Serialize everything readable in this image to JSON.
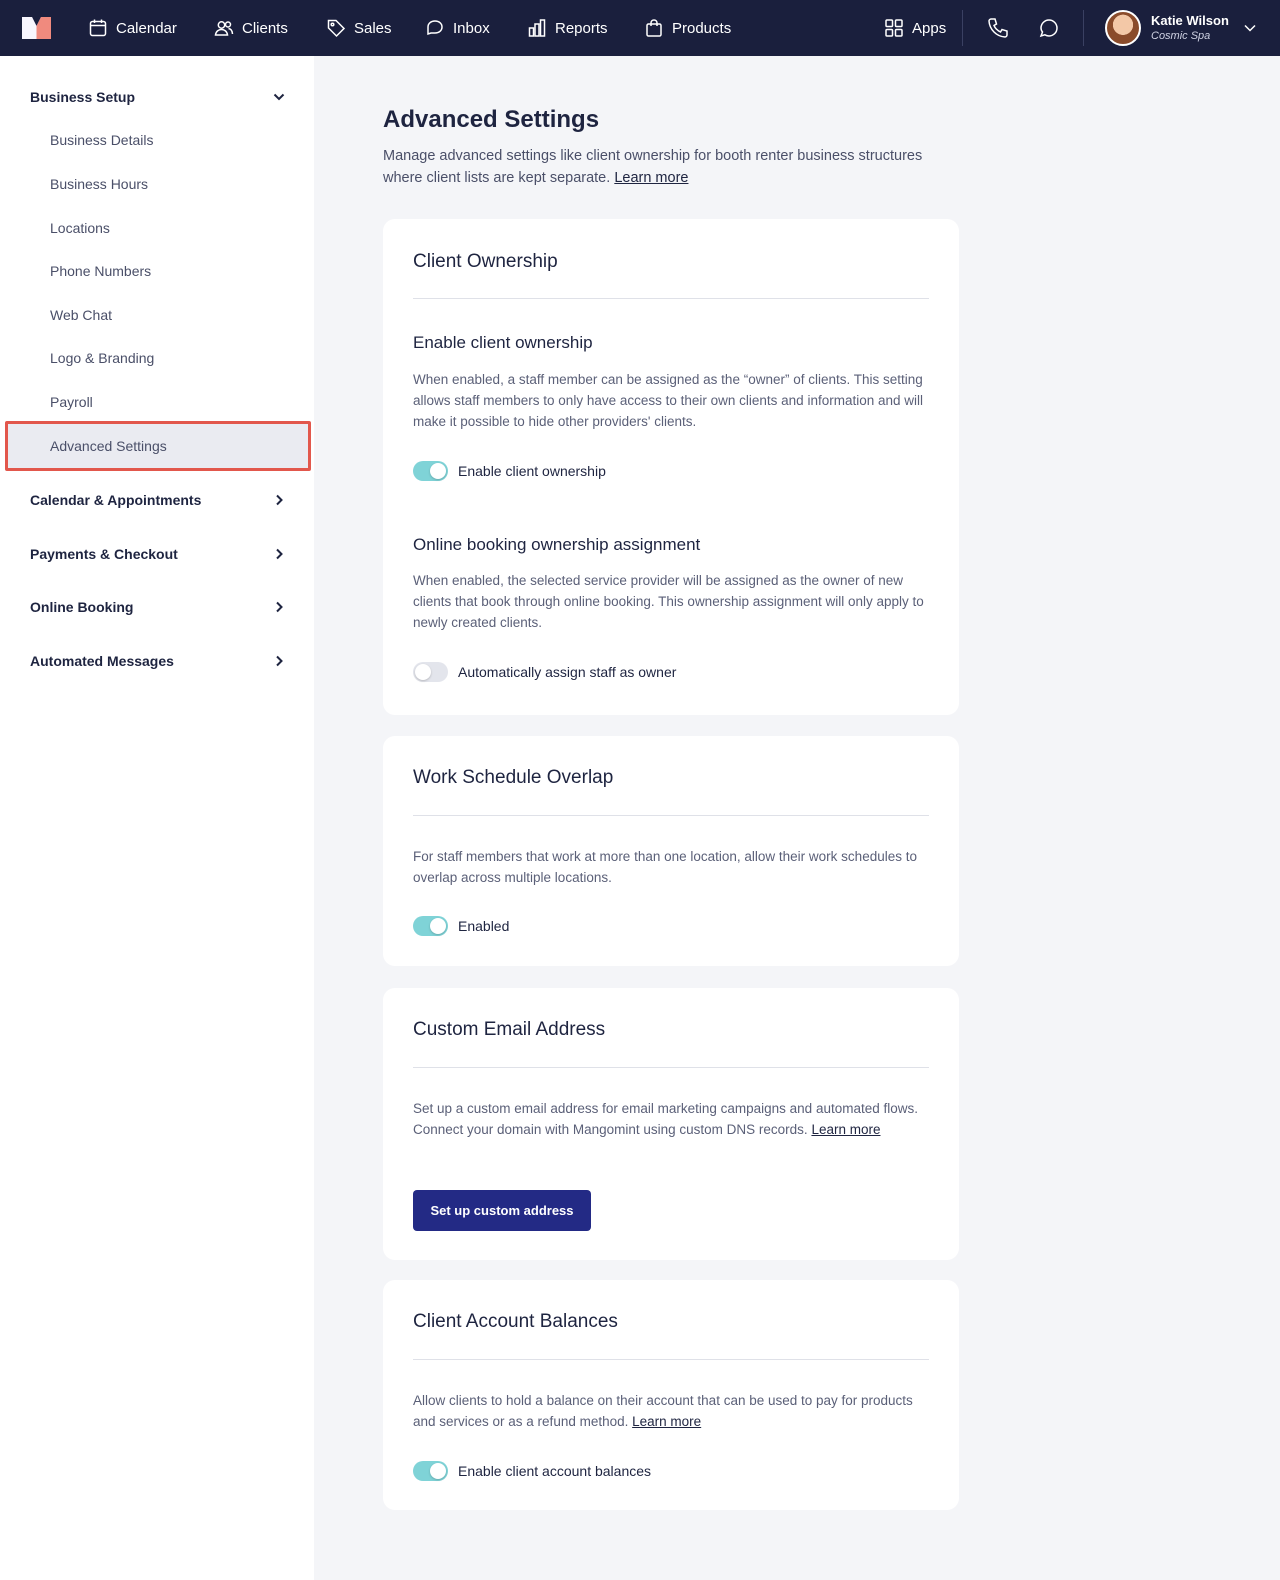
{
  "nav": {
    "items": [
      {
        "label": "Calendar",
        "icon": "calendar-icon"
      },
      {
        "label": "Clients",
        "icon": "users-icon"
      },
      {
        "label": "Sales",
        "icon": "tag-icon"
      },
      {
        "label": "Inbox",
        "icon": "inbox-icon"
      },
      {
        "label": "Reports",
        "icon": "bar-chart-icon"
      },
      {
        "label": "Products",
        "icon": "shopping-bag-icon"
      }
    ],
    "apps_label": "Apps",
    "user": {
      "name": "Katie Wilson",
      "business": "Cosmic Spa"
    }
  },
  "sidebar": {
    "business_setup": "Business Setup",
    "items": [
      {
        "label": "Business Details"
      },
      {
        "label": "Business Hours"
      },
      {
        "label": "Locations"
      },
      {
        "label": "Phone Numbers"
      },
      {
        "label": "Web Chat"
      },
      {
        "label": "Logo & Branding"
      },
      {
        "label": "Payroll"
      },
      {
        "label": "Advanced Settings"
      }
    ],
    "sections": [
      {
        "label": "Calendar & Appointments"
      },
      {
        "label": "Payments & Checkout"
      },
      {
        "label": "Online Booking"
      },
      {
        "label": "Automated Messages"
      }
    ]
  },
  "page": {
    "title": "Advanced Settings",
    "description": "Manage advanced settings like client ownership for booth renter business structures where client lists are kept separate.",
    "learn_more": "Learn more"
  },
  "client_ownership": {
    "title": "Client Ownership",
    "enable_title": "Enable client ownership",
    "enable_desc": "When enabled, a staff member can be assigned as the “owner” of clients. This setting allows staff members to only have access to their own clients and information and will make it possible to hide other providers' clients.",
    "enable_toggle_label": "Enable client ownership",
    "enable_toggle_on": true,
    "booking_title": "Online booking ownership assignment",
    "booking_desc": "When enabled, the selected service provider will be assigned as the owner of new clients that book through online booking. This ownership assignment will only apply to newly created clients.",
    "booking_toggle_label": "Automatically assign staff as owner",
    "booking_toggle_on": false
  },
  "work_schedule": {
    "title": "Work Schedule Overlap",
    "desc": "For staff members that work at more than one location, allow their work schedules to overlap across multiple locations.",
    "toggle_label": "Enabled",
    "toggle_on": true
  },
  "custom_email": {
    "title": "Custom Email Address",
    "desc": "Set up a custom email address for email marketing campaigns and automated flows. Connect your domain with Mangomint using custom DNS records.",
    "learn_more": "Learn more",
    "button_label": "Set up custom address"
  },
  "account_balances": {
    "title": "Client Account Balances",
    "desc": "Allow clients to hold a balance on their account that can be used to pay for products and services or as a refund method.",
    "learn_more": "Learn more",
    "toggle_label": "Enable client account balances",
    "toggle_on": true
  },
  "colors": {
    "topbar": "#1a1f3d",
    "toggle_on": "#7fd3d7",
    "primary_button": "#232a85",
    "active_highlight_border": "#e2574c"
  }
}
